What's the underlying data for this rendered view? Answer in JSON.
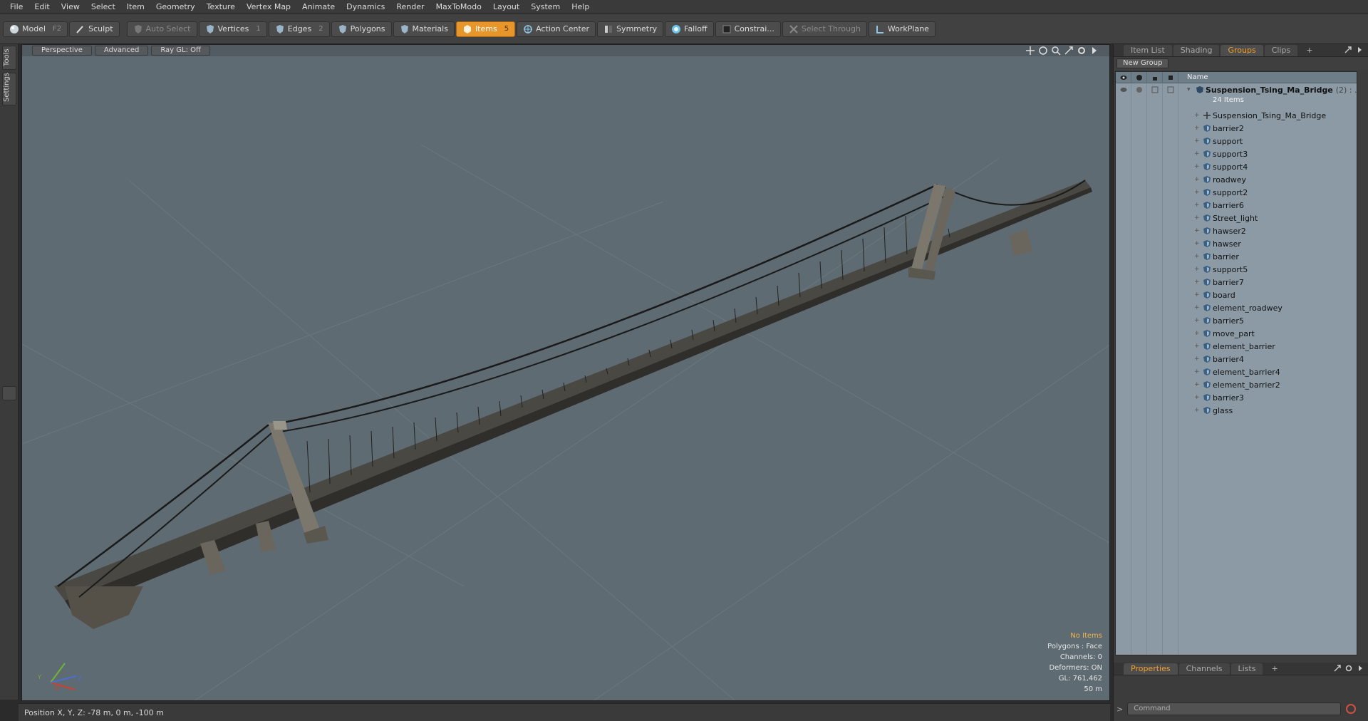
{
  "menu": [
    "File",
    "Edit",
    "View",
    "Select",
    "Item",
    "Geometry",
    "Texture",
    "Vertex Map",
    "Animate",
    "Dynamics",
    "Render",
    "MaxToModo",
    "Layout",
    "System",
    "Help"
  ],
  "toolbar": {
    "model": {
      "label": "Model",
      "key": "F2"
    },
    "sculpt": {
      "label": "Sculpt"
    },
    "auto_select": {
      "label": "Auto Select"
    },
    "vertices": {
      "label": "Vertices",
      "key": "1"
    },
    "edges": {
      "label": "Edges",
      "key": "2"
    },
    "polygons": {
      "label": "Polygons"
    },
    "materials": {
      "label": "Materials"
    },
    "items": {
      "label": "Items",
      "key": "5"
    },
    "action_center": {
      "label": "Action Center"
    },
    "symmetry": {
      "label": "Symmetry"
    },
    "falloff": {
      "label": "Falloff"
    },
    "constraints": {
      "label": "Constrai..."
    },
    "select_through": {
      "label": "Select Through"
    },
    "workplane": {
      "label": "WorkPlane"
    }
  },
  "left_tabs": [
    "Tools",
    "Settings"
  ],
  "viewport": {
    "view_mode": "Perspective",
    "shading": "Advanced",
    "raygl": "Ray GL: Off",
    "hud": {
      "selection": "No Items",
      "polygons": "Polygons : Face",
      "channels": "Channels: 0",
      "deformers": "Deformers: ON",
      "gl": "GL: 761,462",
      "scale": "50 m"
    },
    "axis_labels": {
      "y": "Y",
      "x": "X",
      "z": "Z"
    }
  },
  "status": {
    "position": "Position X, Y, Z:  -78 m, 0 m, -100 m"
  },
  "right_panel": {
    "tabs": [
      "Item List",
      "Shading",
      "Groups",
      "Clips",
      "+"
    ],
    "selected_tab": "Groups",
    "new_group": "New Group",
    "tree_header": "Name",
    "group": {
      "name": "Suspension_Tsing_Ma_Bridge",
      "extra": "(2) : ...",
      "count": "24 Items"
    },
    "items": [
      "Suspension_Tsing_Ma_Bridge",
      "barrier2",
      "support",
      "support3",
      "support4",
      "roadwey",
      "support2",
      "barrier6",
      "Street_light",
      "hawser2",
      "hawser",
      "barrier",
      "support5",
      "barrier7",
      "board",
      "element_roadwey",
      "barrier5",
      "move_part",
      "element_barrier",
      "barrier4",
      "element_barrier4",
      "element_barrier2",
      "barrier3",
      "glass"
    ],
    "bottom_tabs": [
      "Properties",
      "Channels",
      "Lists",
      "+"
    ],
    "bottom_selected": "Properties",
    "command_placeholder": "Command"
  },
  "colors": {
    "accent": "#e7962b",
    "viewport_bg": "#5f6b72",
    "tree_bg": "#8b9aa5"
  }
}
